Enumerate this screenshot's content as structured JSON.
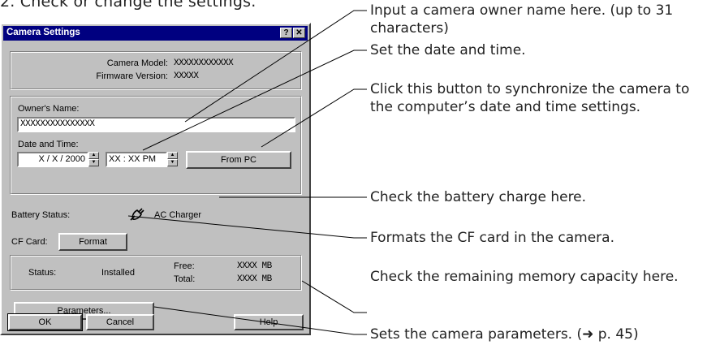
{
  "heading": "2. Check or change the settings.",
  "dialog": {
    "title": "Camera Settings",
    "help_btn": "?",
    "close_btn": "✕",
    "camera_model_label": "Camera Model:",
    "camera_model_value": "XXXXXXXXXXXX",
    "firmware_label": "Firmware Version:",
    "firmware_value": "XXXXX",
    "owner_label": "Owner's Name:",
    "owner_value": "XXXXXXXXXXXXXXX",
    "date_time_label": "Date and Time:",
    "date_value": "X / X / 2000",
    "time_value": "XX : XX  PM",
    "from_pc_button": "From PC",
    "battery_label": "Battery Status:",
    "battery_icon": "plug-icon",
    "battery_value": "AC Charger",
    "cf_card_label": "CF Card:",
    "format_button": "Format",
    "status_label": "Status:",
    "status_value": "Installed",
    "free_label": "Free:",
    "free_value": "XXXX MB",
    "total_label": "Total:",
    "total_value": "XXXX MB",
    "parameters_button": "Parameters...",
    "ok_button": "OK",
    "cancel_button": "Cancel",
    "help_button": "Help"
  },
  "callouts": {
    "owner": "Input a camera owner name here. (up to 31 characters)",
    "datetime": "Set the date and time.",
    "frompc": "Click this button to synchronize the camera to the computer’s date and time settings.",
    "battery": "Check the battery charge here.",
    "format": "Formats the CF card in the camera.",
    "memory": "Check the remaining memory capacity here.",
    "parameters": "Sets the camera parameters. (➜ p. 45)"
  }
}
